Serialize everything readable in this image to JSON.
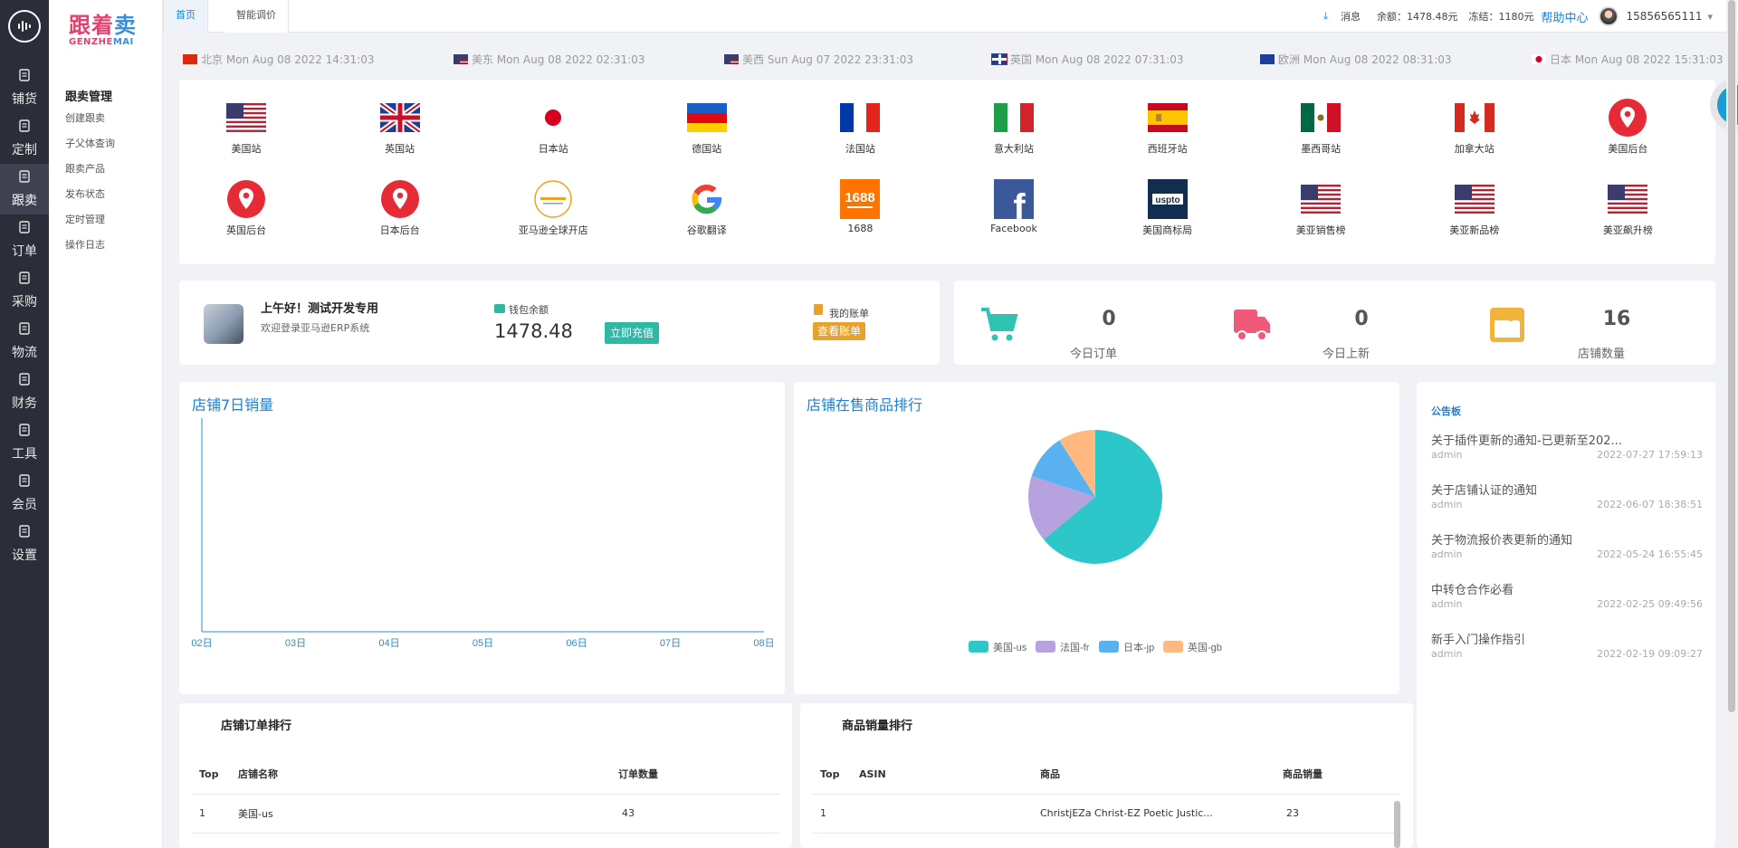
{
  "app": {
    "logo_cn": "跟着卖",
    "logo_en": "GENZHEMAI"
  },
  "rail": [
    {
      "label": "铺货",
      "icon": "document-icon"
    },
    {
      "label": "定制",
      "icon": "edit-document-icon"
    },
    {
      "label": "跟卖",
      "icon": "document-icon",
      "active": true
    },
    {
      "label": "订单",
      "icon": "list-document-icon"
    },
    {
      "label": "采购",
      "icon": "cart-icon"
    },
    {
      "label": "物流",
      "icon": "home-icon"
    },
    {
      "label": "财务",
      "icon": "image-icon"
    },
    {
      "label": "工具",
      "icon": "document-icon"
    },
    {
      "label": "会员",
      "icon": "user-icon"
    },
    {
      "label": "设置",
      "icon": "gear-icon"
    }
  ],
  "submenu": {
    "title": "跟卖管理",
    "items": [
      "创建跟卖",
      "子父体查询",
      "跟卖产品",
      "发布状态",
      "定时管理",
      "操作日志"
    ]
  },
  "tabs": [
    "首页",
    "智能调价"
  ],
  "topbar": {
    "message": "消息",
    "balance": "余额：1478.48元",
    "frozen": "冻结：1180元",
    "help": "帮助中心",
    "phone": "15856565111"
  },
  "clocks": [
    {
      "flag": "cn",
      "text": "北京 Mon Aug 08 2022 14:31:03"
    },
    {
      "flag": "us",
      "text": "美东 Mon Aug 08 2022 02:31:03"
    },
    {
      "flag": "us",
      "text": "美西 Sun Aug 07 2022 23:31:03"
    },
    {
      "flag": "gb",
      "text": "英国 Mon Aug 08 2022 07:31:03"
    },
    {
      "flag": "eu",
      "text": "欧洲 Mon Aug 08 2022 08:31:03"
    },
    {
      "flag": "jp",
      "text": "日本 Mon Aug 08 2022 15:31:03"
    }
  ],
  "sites": [
    {
      "label": "美国站",
      "icon": "us-flag-icon"
    },
    {
      "label": "英国站",
      "icon": "uk-flag-icon"
    },
    {
      "label": "日本站",
      "icon": "japan-flag-icon"
    },
    {
      "label": "德国站",
      "icon": "germany-flag-icon"
    },
    {
      "label": "法国站",
      "icon": "france-flag-icon"
    },
    {
      "label": "意大利站",
      "icon": "italy-flag-icon"
    },
    {
      "label": "西班牙站",
      "icon": "spain-flag-icon"
    },
    {
      "label": "墨西哥站",
      "icon": "mexico-flag-icon"
    },
    {
      "label": "加拿大站",
      "icon": "canada-flag-icon"
    },
    {
      "label": "美国后台",
      "icon": "location-pin-icon"
    },
    {
      "label": "英国后台",
      "icon": "location-pin-icon"
    },
    {
      "label": "日本后台",
      "icon": "location-pin-icon"
    },
    {
      "label": "亚马逊全球开店",
      "icon": "amazon-global-icon"
    },
    {
      "label": "谷歌翻译",
      "icon": "google-icon"
    },
    {
      "label": "1688",
      "icon": "1688-icon"
    },
    {
      "label": "Facebook",
      "icon": "facebook-icon"
    },
    {
      "label": "美国商标局",
      "icon": "uspto-icon"
    },
    {
      "label": "美亚销售榜",
      "icon": "us-flag-icon"
    },
    {
      "label": "美亚新品榜",
      "icon": "us-flag-icon"
    },
    {
      "label": "美亚飙升榜",
      "icon": "us-flag-icon"
    }
  ],
  "user": {
    "greeting": "上午好！测试开发专用",
    "welcome": "欢迎登录亚马逊ERP系统",
    "wallet_label": "钱包余额",
    "wallet_amount": "1478.48",
    "recharge": "立即充值",
    "bill_label": "我的账单",
    "view_bill": "查看账单"
  },
  "stats": [
    {
      "value": "0",
      "label": "今日订单",
      "color": "#2fc4b2",
      "icon": "cart-icon"
    },
    {
      "value": "0",
      "label": "今日上新",
      "color": "#f05a78",
      "icon": "truck-icon"
    },
    {
      "value": "16",
      "label": "店铺数量",
      "color": "#f2b33d",
      "icon": "store-icon"
    }
  ],
  "chart_data": [
    {
      "type": "line",
      "title": "店铺7日销量",
      "categories": [
        "02日",
        "03日",
        "04日",
        "05日",
        "06日",
        "07日",
        "08日"
      ],
      "series": []
    },
    {
      "type": "pie",
      "title": "店铺在售商品排行",
      "legend": [
        "美国-us",
        "法国-fr",
        "日本-jp",
        "英国-gb"
      ],
      "values": [
        64,
        16,
        11,
        9
      ],
      "colors": [
        "#2ec7c9",
        "#b6a2de",
        "#5ab1ef",
        "#ffb980"
      ]
    }
  ],
  "notice": {
    "title": "公告板",
    "items": [
      {
        "title": "关于插件更新的通知-已更新至202...",
        "author": "admin",
        "time": "2022-07-27 17:59:13"
      },
      {
        "title": "关于店铺认证的通知",
        "author": "admin",
        "time": "2022-06-07 18:38:51"
      },
      {
        "title": "关于物流报价表更新的通知",
        "author": "admin",
        "time": "2022-05-24 16:55:45"
      },
      {
        "title": "中转仓合作必看",
        "author": "admin",
        "time": "2022-02-25 09:49:56"
      },
      {
        "title": "新手入门操作指引",
        "author": "admin",
        "time": "2022-02-19 09:09:27"
      }
    ]
  },
  "order_rank": {
    "title": "店铺订单排行",
    "headers": [
      "Top",
      "店铺名称",
      "订单数量"
    ],
    "rows": [
      [
        "1",
        "美国-us",
        "43"
      ]
    ]
  },
  "goods_rank": {
    "title": "商品销量排行",
    "headers": [
      "Top",
      "ASIN",
      "商品",
      "商品销量"
    ],
    "rows": [
      [
        "1",
        "",
        "ChristjEZa Christ-EZ Poetic Justic...",
        "23"
      ]
    ]
  }
}
